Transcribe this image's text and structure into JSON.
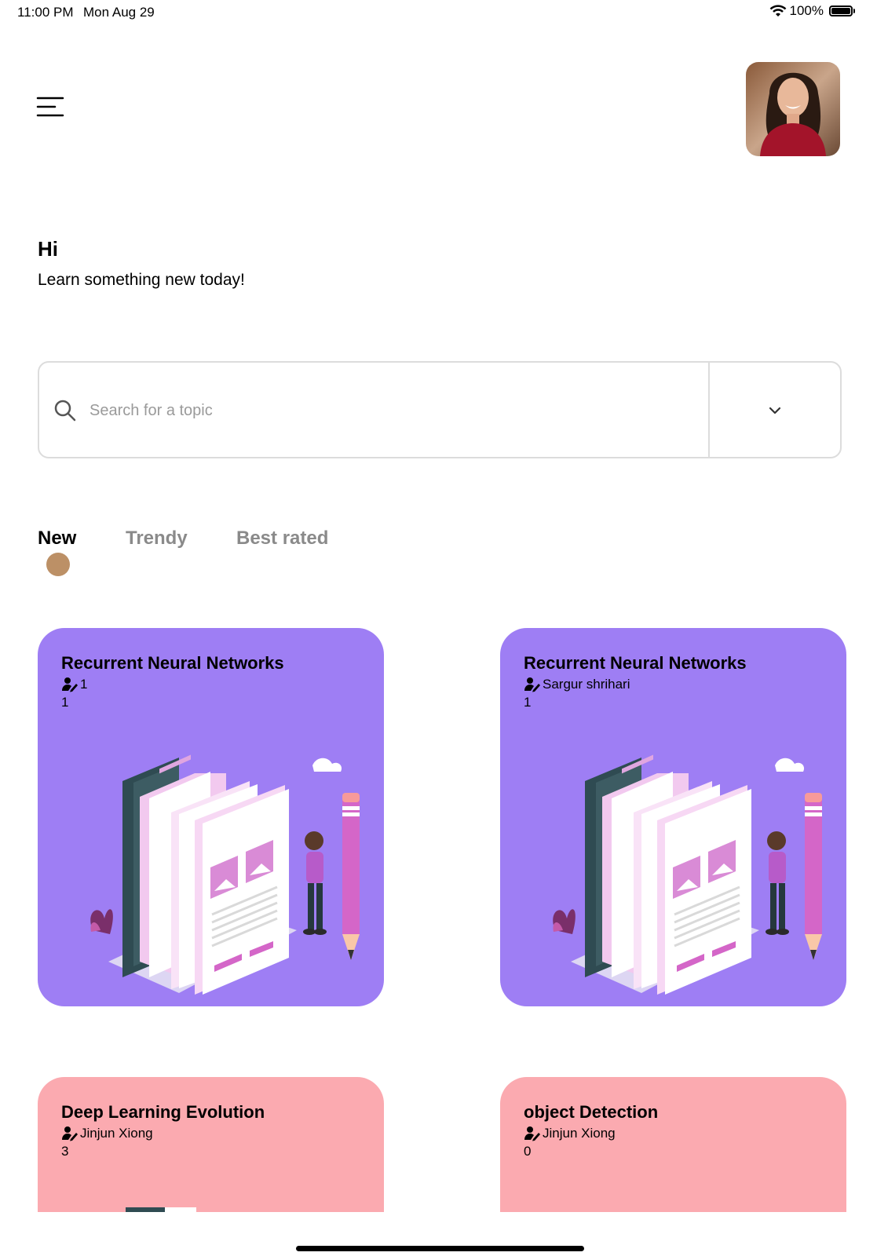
{
  "status_bar": {
    "time": "11:00 PM",
    "date": "Mon Aug 29",
    "battery_text": "100%",
    "battery_level": 1.0
  },
  "header": {
    "menu_icon": "hamburger-menu-icon",
    "avatar_alt": "profile photo"
  },
  "greeting": {
    "title": "Hi",
    "subtitle": "Learn something new today!"
  },
  "search": {
    "placeholder": "Search for a topic",
    "value": "",
    "icon": "search-icon",
    "dropdown_icon": "chevron-down-icon"
  },
  "tabs": [
    {
      "label": "New",
      "active": true
    },
    {
      "label": "Trendy",
      "active": false
    },
    {
      "label": "Best rated",
      "active": false
    }
  ],
  "colors": {
    "accent": "#bc9066",
    "card_purple": "#9e7ef4",
    "card_pink": "#fbaab0",
    "tab_inactive": "#8a8a8a"
  },
  "cards": [
    {
      "title": "Recurrent Neural Networks",
      "author": "1",
      "count": "1",
      "color": "#9e7ef4"
    },
    {
      "title": "Recurrent Neural Networks",
      "author": "Sargur shrihari",
      "count": "1",
      "color": "#9e7ef4"
    },
    {
      "title": "Deep Learning Evolution",
      "author": "Jinjun Xiong",
      "count": "3",
      "color": "#fbaab0"
    },
    {
      "title": "object Detection",
      "author": "Jinjun Xiong",
      "count": "0",
      "color": "#fbaab0"
    }
  ]
}
